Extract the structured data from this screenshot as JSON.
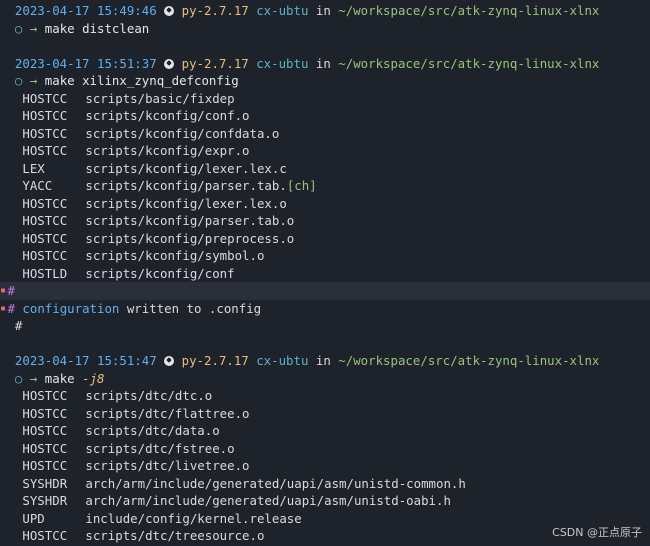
{
  "prompts": [
    {
      "timestamp": "2023-04-17 15:49:46",
      "python_env": "py-2.7.17",
      "host": "cx-ubtu",
      "in_word": "in",
      "cwd": "~/workspace/src/atk-zynq-linux-xlnx",
      "circle": "○",
      "arrow": "→",
      "command": "make distclean"
    },
    {
      "timestamp": "2023-04-17 15:51:37",
      "python_env": "py-2.7.17",
      "host": "cx-ubtu",
      "in_word": "in",
      "cwd": "~/workspace/src/atk-zynq-linux-xlnx",
      "circle": "○",
      "arrow": "→",
      "command": "make xilinx_zynq_defconfig"
    },
    {
      "timestamp": "2023-04-17 15:51:47",
      "python_env": "py-2.7.17",
      "host": "cx-ubtu",
      "in_word": "in",
      "cwd": "~/workspace/src/atk-zynq-linux-xlnx",
      "circle": "○",
      "arrow": "→",
      "command": "make",
      "flag": "-j8"
    }
  ],
  "output_block_1": [
    {
      "tag": "HOSTCC",
      "text": "scripts/basic/fixdep"
    },
    {
      "tag": "HOSTCC",
      "text": "scripts/kconfig/conf.o"
    },
    {
      "tag": "HOSTCC",
      "text": "scripts/kconfig/confdata.o"
    },
    {
      "tag": "HOSTCC",
      "text": "scripts/kconfig/expr.o"
    },
    {
      "tag": "LEX",
      "text": "scripts/kconfig/lexer.lex.c"
    },
    {
      "tag": "YACC",
      "text": "scripts/kconfig/parser.tab.",
      "extra": "[ch]"
    },
    {
      "tag": "HOSTCC",
      "text": "scripts/kconfig/lexer.lex.o"
    },
    {
      "tag": "HOSTCC",
      "text": "scripts/kconfig/parser.tab.o"
    },
    {
      "tag": "HOSTCC",
      "text": "scripts/kconfig/preprocess.o"
    },
    {
      "tag": "HOSTCC",
      "text": "scripts/kconfig/symbol.o"
    },
    {
      "tag": "HOSTLD",
      "text": "scripts/kconfig/conf"
    }
  ],
  "config_block": {
    "hash": "#",
    "config_word": "configuration",
    "config_rest": " written to .config"
  },
  "output_block_2": [
    {
      "tag": "HOSTCC",
      "text": "scripts/dtc/dtc.o"
    },
    {
      "tag": "HOSTCC",
      "text": "scripts/dtc/flattree.o"
    },
    {
      "tag": "HOSTCC",
      "text": "scripts/dtc/data.o"
    },
    {
      "tag": "HOSTCC",
      "text": "scripts/dtc/fstree.o"
    },
    {
      "tag": "HOSTCC",
      "text": "scripts/dtc/livetree.o"
    },
    {
      "tag": "SYSHDR",
      "text": "arch/arm/include/generated/uapi/asm/unistd-common.h"
    },
    {
      "tag": "SYSHDR",
      "text": "arch/arm/include/generated/uapi/asm/unistd-oabi.h"
    },
    {
      "tag": "UPD",
      "text": "include/config/kernel.release"
    },
    {
      "tag": "HOSTCC",
      "text": "scripts/dtc/treesource.o"
    }
  ],
  "watermark": "CSDN @正点原子",
  "icons": {
    "python": "python-icon",
    "prompt_circle": "circle-icon",
    "prompt_arrow": "arrow-icon"
  }
}
